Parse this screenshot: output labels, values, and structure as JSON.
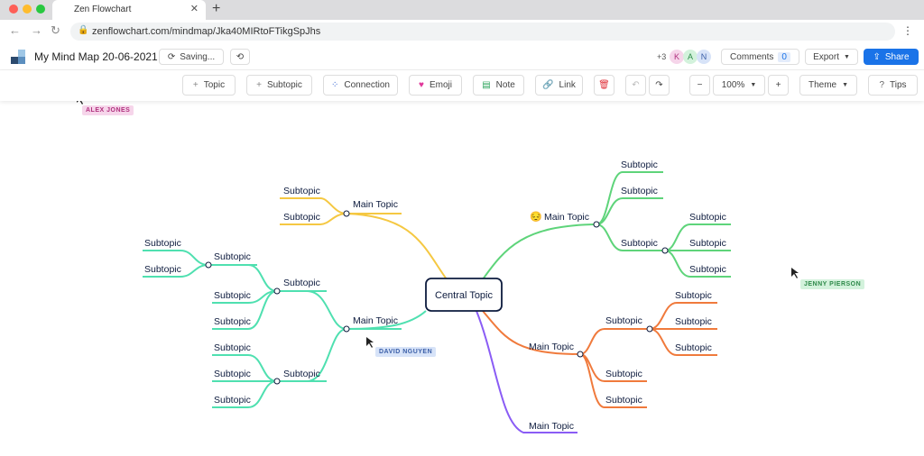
{
  "browser": {
    "tab_title": "Zen Flowchart",
    "tab_close": "✕",
    "new_tab": "+",
    "url": "zenflowchart.com/mindmap/Jka40MIRtoFTikgSpJhs"
  },
  "header": {
    "doc_title": "My Mind Map 20-06-2021",
    "saving_label": "Saving...",
    "collab_count": "+3",
    "avatars": [
      "K",
      "A",
      "N"
    ],
    "comments_label": "Comments",
    "comments_count": "0",
    "export_label": "Export",
    "share_label": "Share"
  },
  "toolbar": {
    "topic": "Topic",
    "subtopic": "Subtopic",
    "connection": "Connection",
    "emoji": "Emoji",
    "note": "Note",
    "link": "Link",
    "zoom": "100%",
    "theme": "Theme",
    "tips": "Tips"
  },
  "colors": {
    "accent": "#1a73e8",
    "yellow": "#f5c842",
    "teal": "#4fe0b0",
    "green": "#5ed47a",
    "orange": "#f07a3c",
    "purple": "#8a5cf5"
  },
  "mindmap": {
    "central": "Central Topic",
    "yellow_main": "Main Topic",
    "yellow_subs": [
      "Subtopic",
      "Subtopic"
    ],
    "teal_main": "Main Topic",
    "teal_sub1": "Subtopic",
    "teal_sub1_sub": "Subtopic",
    "teal_sub1_sub_leaves": [
      "Subtopic",
      "Subtopic"
    ],
    "teal_sub1_leaves": [
      "Subtopic",
      "Subtopic"
    ],
    "teal_sub2": "Subtopic",
    "teal_sub2_leaves": [
      "Subtopic",
      "Subtopic",
      "Subtopic"
    ],
    "green_main": "Main Topic",
    "green_main_emoji": "😔",
    "green_subs": [
      "Subtopic",
      "Subtopic"
    ],
    "green_sub3": "Subtopic",
    "green_sub3_leaves": [
      "Subtopic",
      "Subtopic",
      "Subtopic"
    ],
    "orange_main": "Main Topic",
    "orange_sub1": "Subtopic",
    "orange_sub1_leaves": [
      "Subtopic",
      "Subtopic",
      "Subtopic"
    ],
    "orange_subs": [
      "Subtopic",
      "Subtopic"
    ],
    "purple_main": "Main Topic"
  },
  "cursors": {
    "alex": "ALEX JONES",
    "david": "DAVID NGUYEN",
    "jenny": "JENNY PIERSON"
  }
}
